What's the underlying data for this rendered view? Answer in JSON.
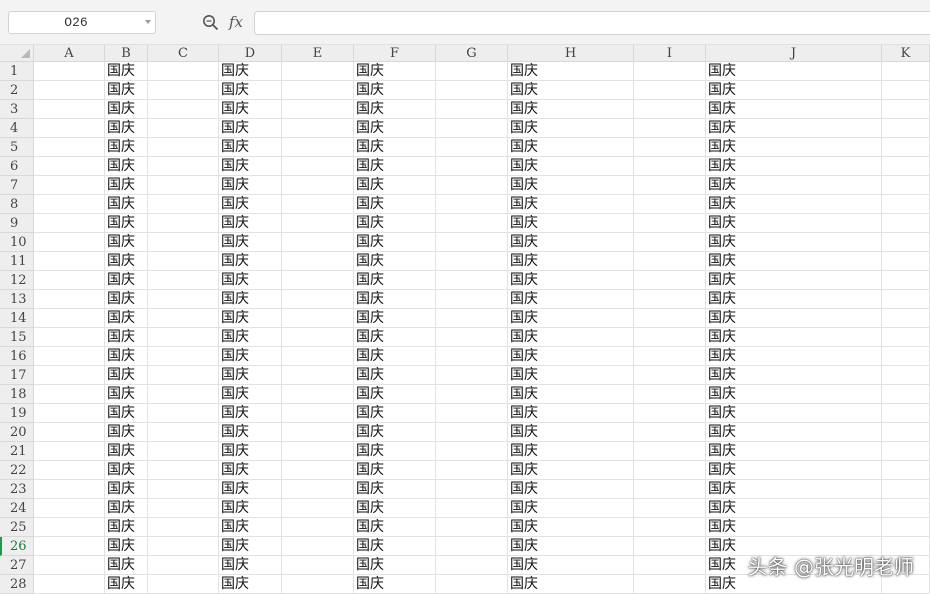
{
  "formula_bar": {
    "name_box_value": "O26",
    "fx_label": "fx",
    "formula_value": ""
  },
  "active_row": "26",
  "grid": {
    "columns": [
      "A",
      "B",
      "C",
      "D",
      "E",
      "F",
      "G",
      "H",
      "I",
      "J",
      "K"
    ],
    "rows": [
      "1",
      "2",
      "3",
      "4",
      "5",
      "6",
      "7",
      "8",
      "9",
      "10",
      "11",
      "12",
      "13",
      "14",
      "15",
      "16",
      "17",
      "18",
      "19",
      "20",
      "21",
      "22",
      "23",
      "24",
      "25",
      "26",
      "27",
      "28"
    ],
    "filled_columns": [
      "B",
      "D",
      "F",
      "H",
      "J"
    ],
    "cell_text": "国庆"
  },
  "watermark": "头条 @张光明老师",
  "colors": {
    "active_row_indicator": "#1f9a46",
    "header_bg": "#eeeeee",
    "grid_line": "#e2e2e2"
  }
}
